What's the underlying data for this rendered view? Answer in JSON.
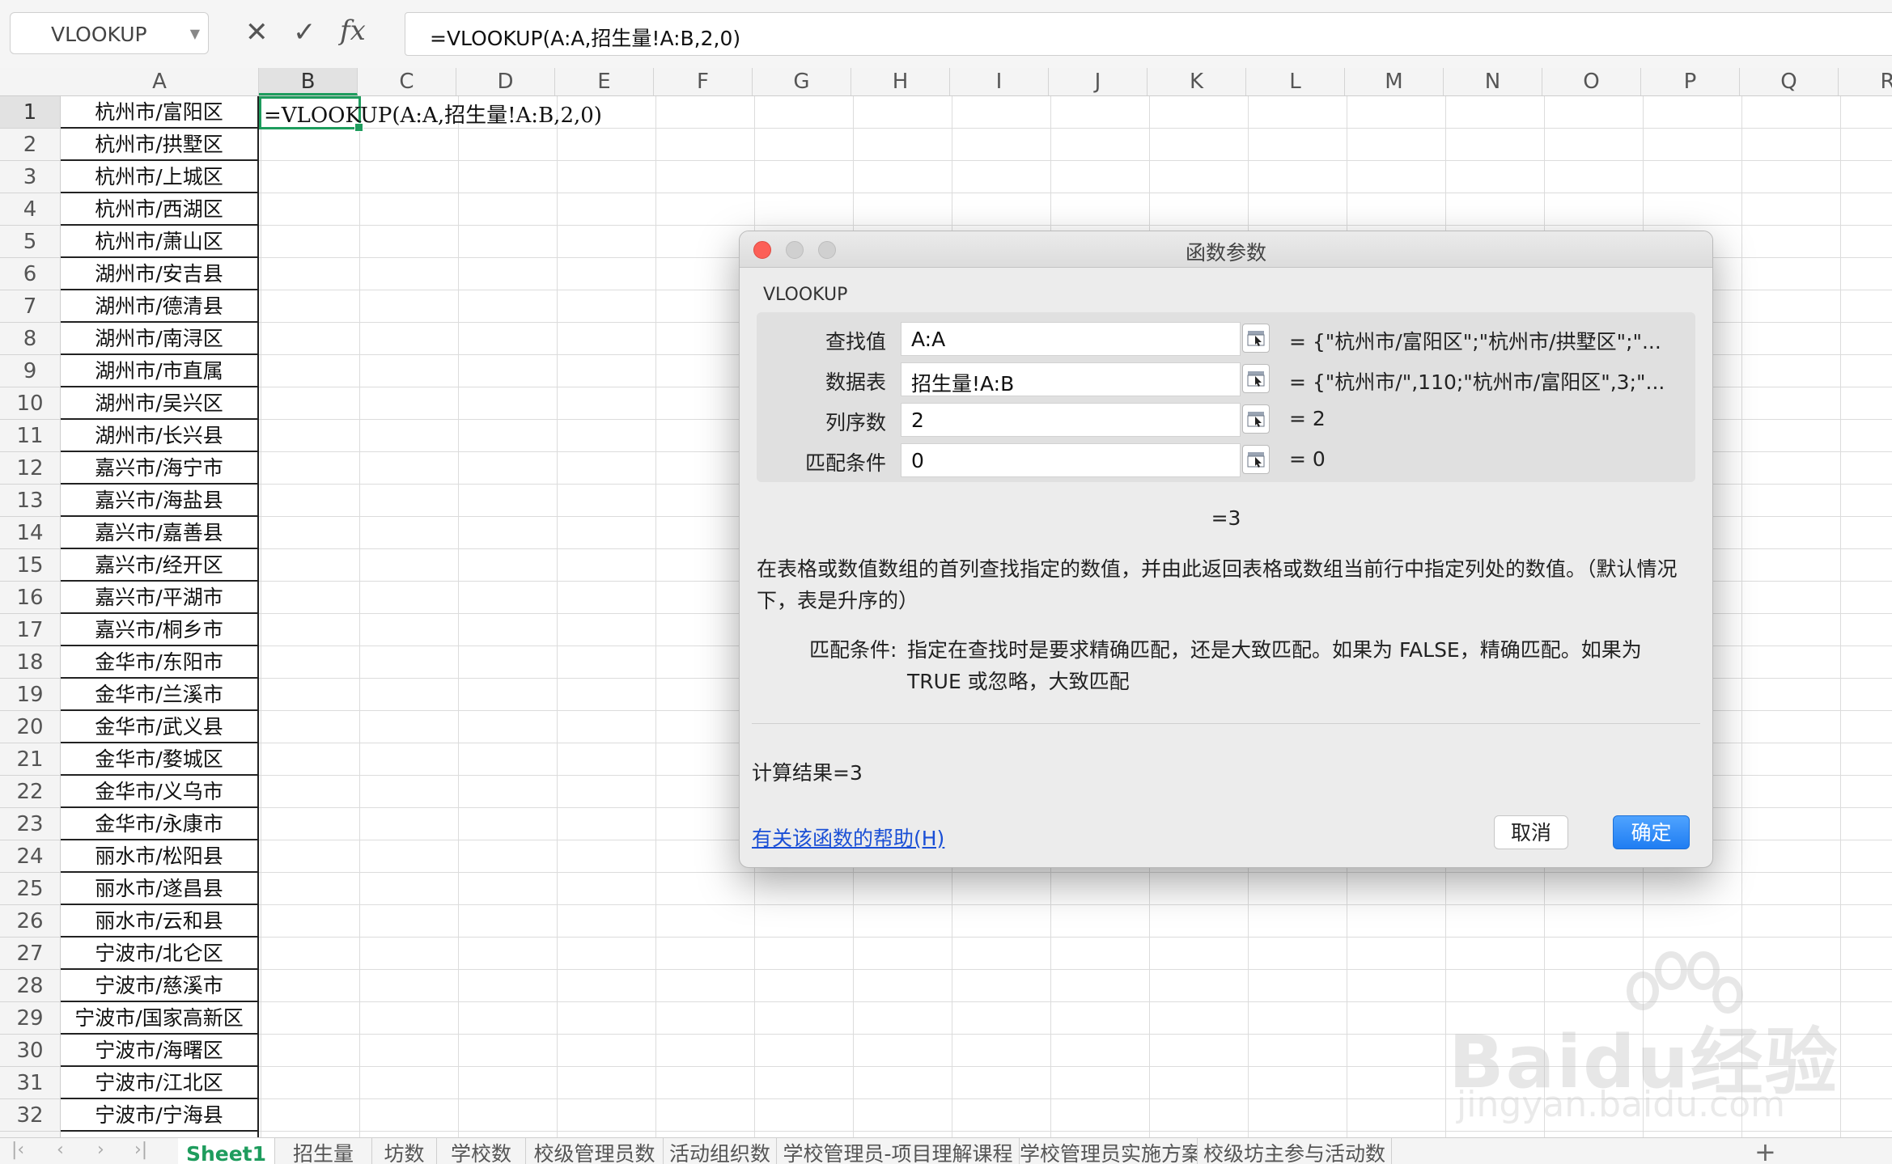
{
  "formula_bar": {
    "name_box": "VLOOKUP",
    "cancel_icon": "close-icon",
    "confirm_icon": "check-icon",
    "fx_label": "fx",
    "formula": "=VLOOKUP(A:A,招生量!A:B,2,0)"
  },
  "columns": [
    "A",
    "B",
    "C",
    "D",
    "E",
    "F",
    "G",
    "H",
    "I",
    "J",
    "K",
    "L",
    "M",
    "N",
    "O",
    "P",
    "Q",
    "R"
  ],
  "rows": [
    "1",
    "2",
    "3",
    "4",
    "5",
    "6",
    "7",
    "8",
    "9",
    "10",
    "11",
    "12",
    "13",
    "14",
    "15",
    "16",
    "17",
    "18",
    "19",
    "20",
    "21",
    "22",
    "23",
    "24",
    "25",
    "26",
    "27",
    "28",
    "29",
    "30",
    "31",
    "32"
  ],
  "column_a": [
    "杭州市/富阳区",
    "杭州市/拱墅区",
    "杭州市/上城区",
    "杭州市/西湖区",
    "杭州市/萧山区",
    "湖州市/安吉县",
    "湖州市/德清县",
    "湖州市/南浔区",
    "湖州市/市直属",
    "湖州市/吴兴区",
    "湖州市/长兴县",
    "嘉兴市/海宁市",
    "嘉兴市/海盐县",
    "嘉兴市/嘉善县",
    "嘉兴市/经开区",
    "嘉兴市/平湖市",
    "嘉兴市/桐乡市",
    "金华市/东阳市",
    "金华市/兰溪市",
    "金华市/武义县",
    "金华市/婺城区",
    "金华市/义乌市",
    "金华市/永康市",
    "丽水市/松阳县",
    "丽水市/遂昌县",
    "丽水市/云和县",
    "宁波市/北仑区",
    "宁波市/慈溪市",
    "宁波市/国家高新区",
    "宁波市/海曙区",
    "宁波市/江北区",
    "宁波市/宁海县"
  ],
  "active_cell": {
    "ref": "B1",
    "text": "=VLOOKUP(A:A,招生量!A:B,2,0)"
  },
  "dialog": {
    "title": "函数参数",
    "function_name": "VLOOKUP",
    "args": [
      {
        "label": "查找值",
        "value": "A:A",
        "result": "= {\"杭州市/富阳区\";\"杭州市/拱墅区\";\"..."
      },
      {
        "label": "数据表",
        "value": "招生量!A:B",
        "result": "= {\"杭州市/\",110;\"杭州市/富阳区\",3;\"..."
      },
      {
        "label": "列序数",
        "value": "2",
        "result": "= 2"
      },
      {
        "label": "匹配条件",
        "value": "0",
        "result": "= 0"
      }
    ],
    "result_line": "=3",
    "description": "在表格或数值数组的首列查找指定的数值，并由此返回表格或数组当前行中指定列处的数值。（默认情况下，表是升序的）",
    "param_label": "匹配条件:",
    "param_desc": "指定在查找时是要求精确匹配，还是大致匹配。如果为 FALSE，精确匹配。如果为 TRUE 或忽略，大致匹配",
    "calc_result": "计算结果=3",
    "help_link": "有关该函数的帮助(H)",
    "cancel_label": "取消",
    "ok_label": "确定",
    "accent_color": "#1f7df2"
  },
  "sheet_tabs": [
    "Sheet1",
    "招生量",
    "坊数",
    "学校数",
    "校级管理员数",
    "活动组织数",
    "学校管理员-项目理解课程",
    "学校管理员实施方案",
    "校级坊主参与活动数"
  ],
  "active_tab": "Sheet1",
  "watermark": {
    "brand": "Baidu经验",
    "site": "jingyan.baidu.com"
  },
  "theme": {
    "selection_green": "#1e9c5d"
  }
}
